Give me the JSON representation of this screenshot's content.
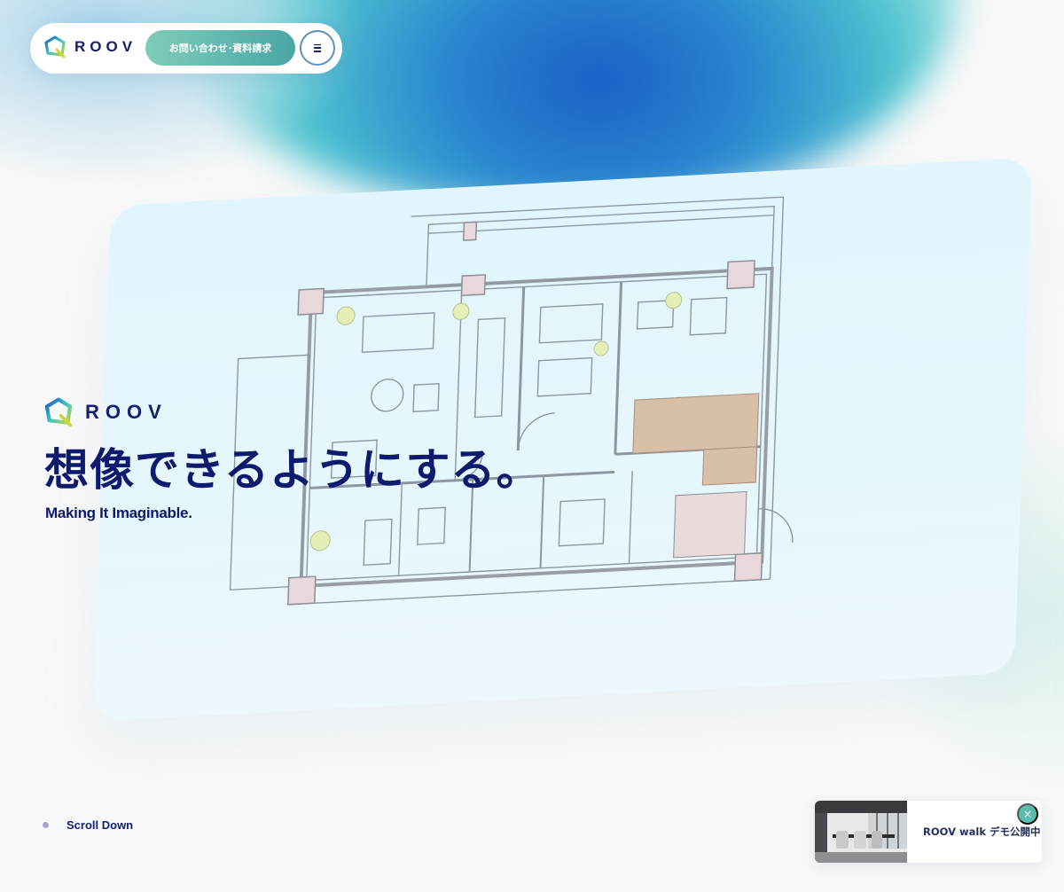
{
  "header": {
    "logo_text": "ROOV",
    "contact_label": "お問い合わせ･資料請求",
    "menu_icon": "hamburger-icon"
  },
  "hero": {
    "logo_text": "ROOV",
    "title": "想像できるようにする。",
    "subtitle": "Making It Imaginable.",
    "background_image": "floor-plan"
  },
  "scroll": {
    "label": "Scroll Down"
  },
  "demo_banner": {
    "label": "ROOV walk デモ公開中",
    "close_label": "×",
    "thumbnail": "interior-dining-room-photo"
  },
  "colors": {
    "brand_navy": "#0d1a6e",
    "accent_teal": "#5bbdb0",
    "button_gradient_start": "#7fcdb8",
    "button_gradient_end": "#4aa6a6"
  }
}
